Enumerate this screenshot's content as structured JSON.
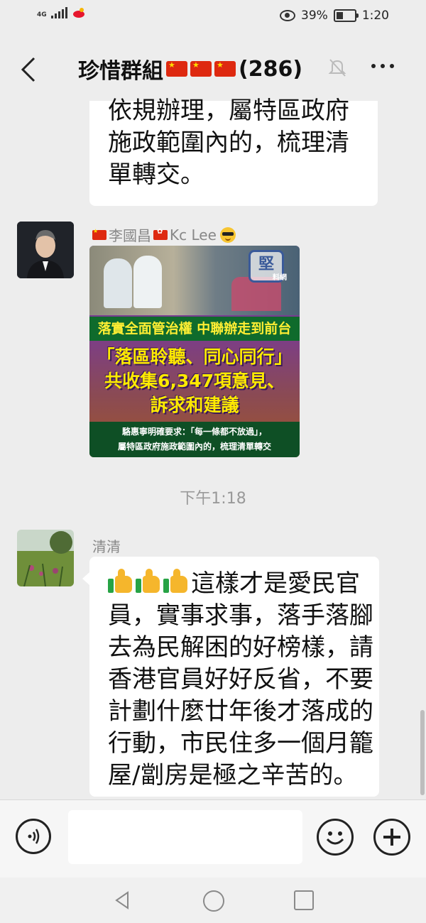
{
  "status_bar": {
    "network": "4G",
    "battery_percent": "39%",
    "battery_level": 0.39,
    "time": "1:20"
  },
  "header": {
    "title": "珍惜群組",
    "member_count": "(286)",
    "icons": [
      "back-arrow-icon",
      "china-flag-icon",
      "mute-bell-icon",
      "more-icon"
    ]
  },
  "messages": [
    {
      "type": "text",
      "text": "依規辦理，屬特區政府\n施政範圍內的，梳理清\n單轉交。"
    },
    {
      "type": "image",
      "sender": "李國昌",
      "sender_suffix": "Kc Lee",
      "card": {
        "logo": "堅",
        "logo_sub": "料網",
        "headline": "落實全面管治權 中聯辦走到前台",
        "big_line1": "「落區聆聽、同心同行」",
        "big_line2": "共收集6,347項意見、",
        "big_line3": "訴求和建議",
        "foot_line1": "駱惠寧明確要求：「每一條都不放過」，",
        "foot_line2": "屬特區政府施政範圍內的，梳理清單轉交"
      }
    },
    {
      "type": "timestamp",
      "text": "下午1:18"
    },
    {
      "type": "text",
      "sender": "清清",
      "text": "這樣才是愛民官\n員，實事求事，落手落腳\n去為民解困的好榜樣，請\n香港官員好好反省，不要\n計劃什麼廿年後才落成的\n行動，市民住多一個月籠\n屋/劏房是極之辛苦的。"
    }
  ],
  "input_bar": {
    "placeholder": "",
    "icons": [
      "voice-icon",
      "emoji-icon",
      "plus-icon"
    ]
  }
}
